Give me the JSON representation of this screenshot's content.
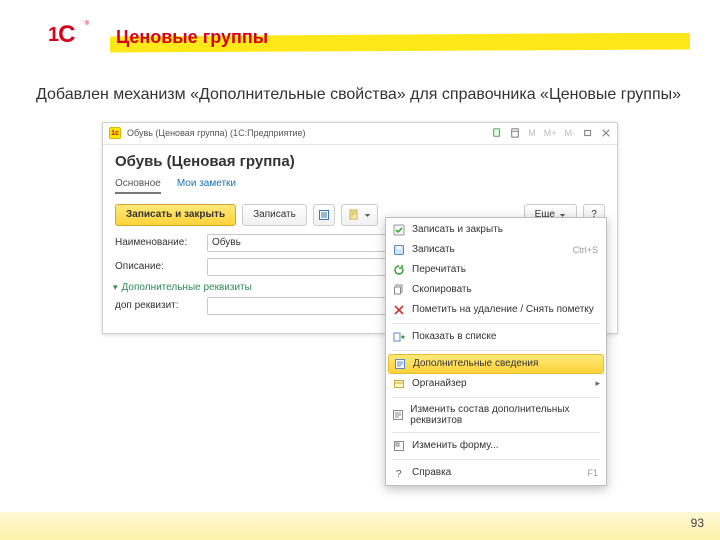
{
  "slide": {
    "title": "Ценовые группы",
    "lead": "Добавлен механизм «Дополнительные свойства» для справочника «Ценовые группы»",
    "page": "93"
  },
  "win": {
    "icon_text": "1c",
    "title": "Обувь (Ценовая группа) (1С:Предприятие)",
    "ctrl_M": "M",
    "ctrl_Mplus": "M+",
    "ctrl_Mminus": "M-"
  },
  "form": {
    "title": "Обувь (Ценовая группа)",
    "tabs": {
      "main": "Основное",
      "notes": "Мои заметки"
    }
  },
  "toolbar": {
    "save_close": "Записать и закрыть",
    "save": "Записать",
    "more": "Еще",
    "help": "?"
  },
  "fields": {
    "name_label": "Наименование:",
    "name_value": "Обувь",
    "desc_label": "Описание:",
    "desc_value": "",
    "group": "Дополнительные реквизиты",
    "extra_label": "доп реквизит:",
    "extra_value": ""
  },
  "menu": {
    "save_close": "Записать и закрыть",
    "save": "Записать",
    "save_accel": "Ctrl+S",
    "reread": "Перечитать",
    "copy": "Скопировать",
    "delete_mark": "Пометить на удаление / Снять пометку",
    "show_list": "Показать в списке",
    "extra_info": "Дополнительные сведения",
    "organizer": "Органайзер",
    "change_attrs": "Изменить состав дополнительных реквизитов",
    "change_form": "Изменить форму...",
    "help": "Справка",
    "help_accel": "F1"
  }
}
